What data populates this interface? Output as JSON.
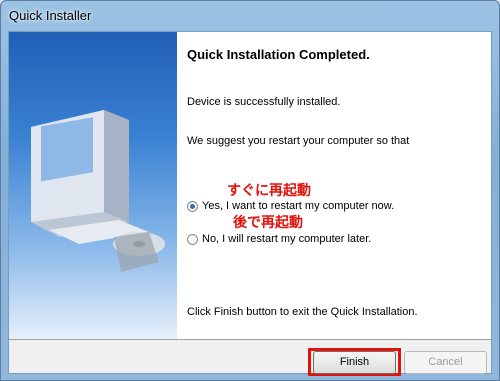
{
  "window": {
    "title": "Quick Installer"
  },
  "content": {
    "heading": "Quick Installation Completed.",
    "device_status": "Device is successfully installed.",
    "suggestion": "We suggest you restart your computer so that",
    "annotation_restart_now": "すぐに再起動",
    "annotation_restart_later": "後で再起動",
    "options": [
      {
        "label": "Yes, I want to restart my computer now.",
        "selected": true
      },
      {
        "label": "No, I will restart my computer later.",
        "selected": false
      }
    ],
    "footer_text": "Click Finish button to exit the Quick Installation."
  },
  "buttons": {
    "finish": "Finish",
    "cancel": "Cancel"
  },
  "colors": {
    "annotation": "#e3120b",
    "left_panel_top": "#1f5fb5"
  },
  "icons": {
    "illustration": "computer-with-cd-icon"
  }
}
